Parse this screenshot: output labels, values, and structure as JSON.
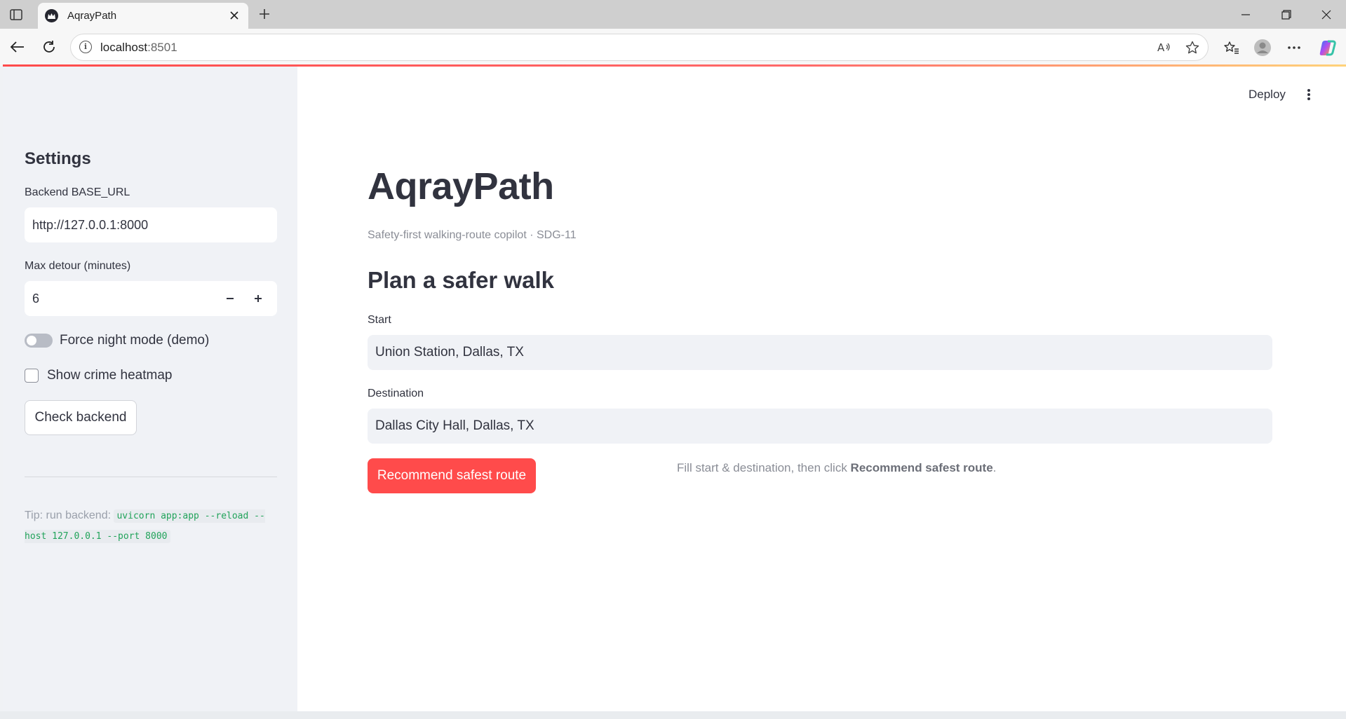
{
  "browser": {
    "tab_title": "AqrayPath",
    "url_host": "localhost",
    "url_port": ":8501"
  },
  "sidebar": {
    "heading": "Settings",
    "base_url_label": "Backend BASE_URL",
    "base_url_value": "http://127.0.0.1:8000",
    "detour_label": "Max detour (minutes)",
    "detour_value": "6",
    "night_mode_label": "Force night mode (demo)",
    "night_mode_on": false,
    "heatmap_label": "Show crime heatmap",
    "heatmap_checked": false,
    "check_button": "Check backend",
    "tip_prefix": "Tip: run backend: ",
    "tip_command": "uvicorn app:app --reload --host 127.0.0.1 --port 8000"
  },
  "header": {
    "deploy_label": "Deploy"
  },
  "main": {
    "title": "AqrayPath",
    "caption": "Safety-first walking-route copilot · SDG-11",
    "section_title": "Plan a safer walk",
    "start_label": "Start",
    "start_value": "Union Station, Dallas, TX",
    "destination_label": "Destination",
    "destination_value": "Dallas City Hall, Dallas, TX",
    "primary_button": "Recommend safest route",
    "hint_prefix": "Fill start & destination, then click ",
    "hint_bold": "Recommend safest route",
    "hint_suffix": "."
  },
  "colors": {
    "accent": "#ff4b4b",
    "sidebar_bg": "#f0f2f6",
    "code_text": "#21a35a"
  }
}
